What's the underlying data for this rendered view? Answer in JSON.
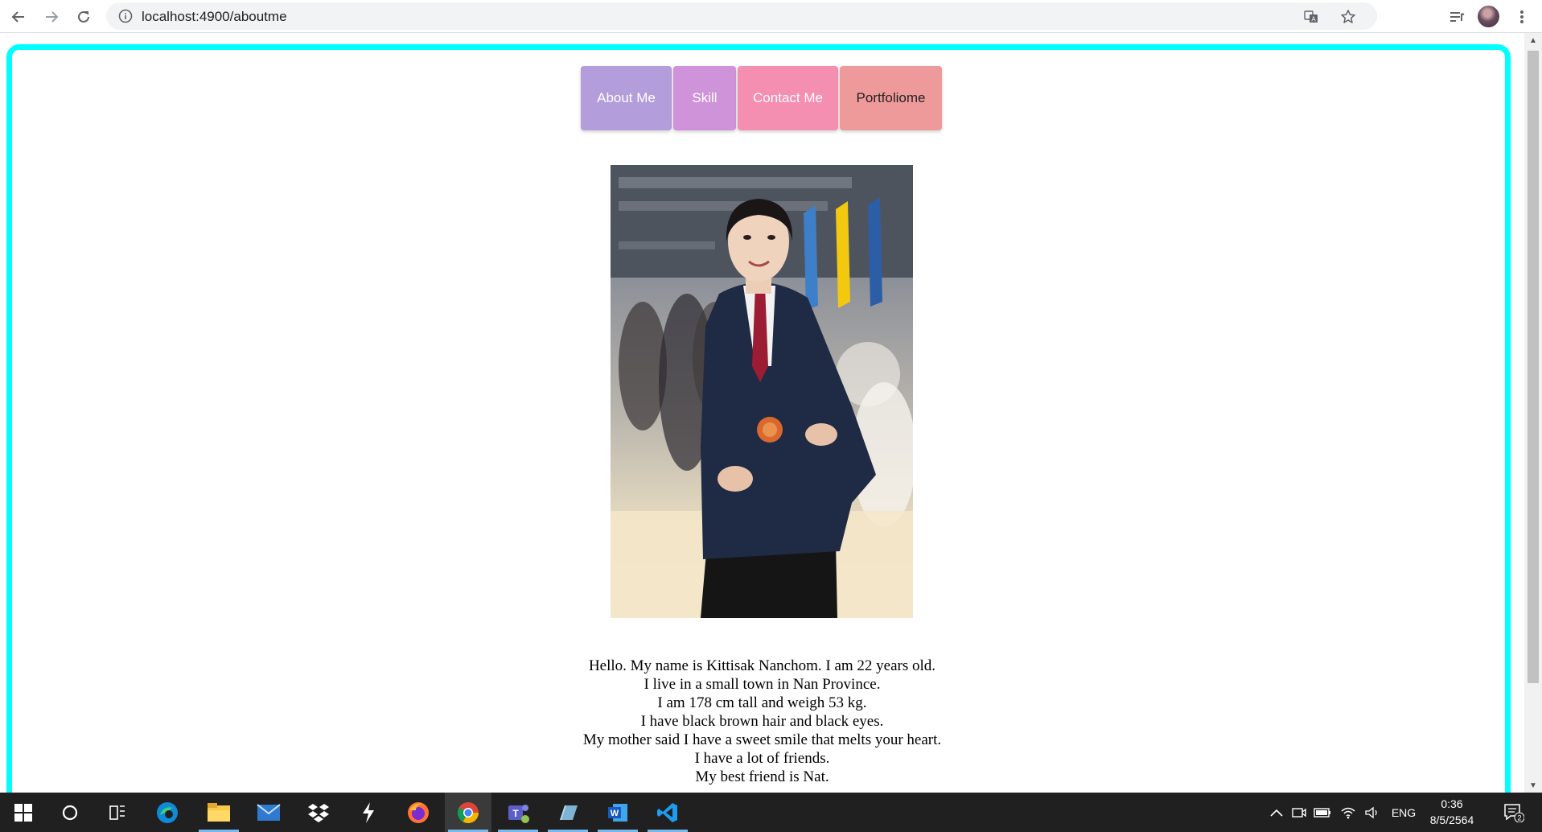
{
  "browser": {
    "url": "localhost:4900/aboutme",
    "nav_icons": [
      "back-arrow-icon",
      "forward-arrow-icon",
      "reload-icon"
    ],
    "omnibox_icons": [
      "translate-icon",
      "bookmark-star-icon"
    ],
    "toolbar_icons": [
      "reading-list-icon",
      "profile-avatar",
      "more-menu-icon"
    ]
  },
  "nav": {
    "buttons": [
      {
        "label": "About Me",
        "bg": "#b39ddb",
        "fg": "#ffffff"
      },
      {
        "label": "Skill",
        "bg": "#ce93d8",
        "fg": "#ffffff"
      },
      {
        "label": "Contact Me",
        "bg": "#f48fb1",
        "fg": "#ffffff"
      },
      {
        "label": "Portfoliome",
        "bg": "#ef9a9a",
        "fg": "#222222"
      }
    ]
  },
  "colors": {
    "frame_border": "#00ffff",
    "taskbar": "#202020"
  },
  "bio": {
    "lines": [
      "Hello. My name is Kittisak Nanchom. I am 22 years old.",
      "I live in a small town in Nan Province.",
      "I am 178 cm tall and weigh 53 kg.",
      "I have black brown hair and black eyes.",
      "My mother said I have a sweet smile that melts your heart.",
      "I have a lot of friends.",
      "My best friend is Nat."
    ]
  },
  "taskbar": {
    "apps": [
      "windows-start-icon",
      "search-circle-icon",
      "task-view-icon",
      "edge-icon",
      "file-explorer-icon",
      "mail-icon",
      "dropbox-icon",
      "app-s-icon",
      "firefox-icon",
      "chrome-icon",
      "teams-icon",
      "notes-icon",
      "word-icon",
      "vscode-icon"
    ],
    "active_app": "chrome-icon",
    "language": "ENG",
    "time": "0:36",
    "date": "8/5/2564",
    "notification_count": "2"
  }
}
